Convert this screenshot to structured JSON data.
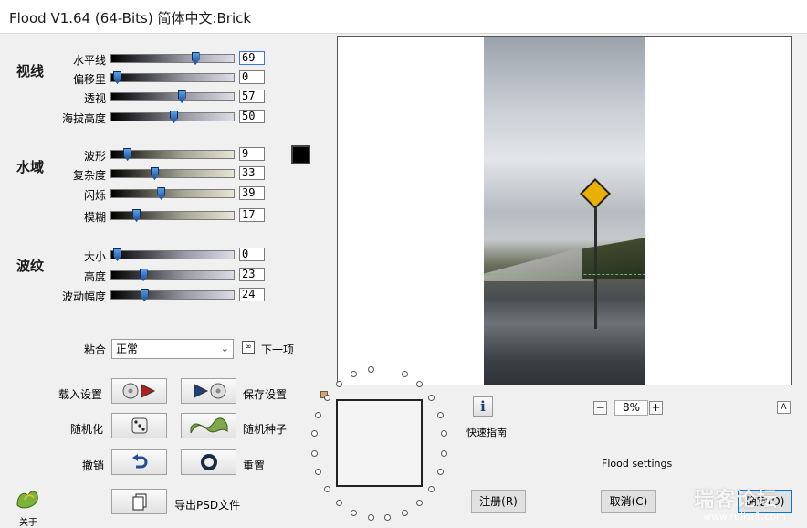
{
  "window": {
    "title": "Flood V1.64 (64-Bits)  简体中文:Brick"
  },
  "groups": {
    "view": {
      "label": "视线"
    },
    "water": {
      "label": "水域"
    },
    "waves": {
      "label": "波纹"
    }
  },
  "sliders": [
    {
      "label": "水平线",
      "value": "69",
      "fraction": 0.69
    },
    {
      "label": "偏移里",
      "value": "0",
      "fraction": 0.0
    },
    {
      "label": "透视",
      "value": "57",
      "fraction": 0.57
    },
    {
      "label": "海拔高度",
      "value": "50",
      "fraction": 0.5
    },
    {
      "label": "波形",
      "value": "9",
      "fraction": 0.09
    },
    {
      "label": "复杂度",
      "value": "33",
      "fraction": 0.33
    },
    {
      "label": "闪烁",
      "value": "39",
      "fraction": 0.39
    },
    {
      "label": "模糊",
      "value": "17",
      "fraction": 0.17
    },
    {
      "label": "大小",
      "value": "0",
      "fraction": 0.0
    },
    {
      "label": "高度",
      "value": "23",
      "fraction": 0.23
    },
    {
      "label": "波动幅度",
      "value": "24",
      "fraction": 0.24
    }
  ],
  "blend": {
    "label": "粘合",
    "selected": "正常",
    "next_label": "下一项"
  },
  "buttons": {
    "load_settings": "载入设置",
    "save_settings": "保存设置",
    "randomize": "随机化",
    "random_seed": "随机种子",
    "undo": "撤销",
    "reset": "重置",
    "export_psd": "导出PSD文件",
    "about": "关于",
    "quick_guide": "快速指南",
    "register": "注册(R)",
    "cancel": "取消(C)",
    "ok": "确定(O)"
  },
  "zoom": {
    "value": "8%"
  },
  "status": {
    "settings_text": "Flood settings"
  },
  "watermark": {
    "main": "瑞客论坛",
    "sub": "www.ruike1.com"
  },
  "colors": {
    "accent": "#0078d7",
    "water_color": "#000000",
    "thumb": "#2a6fc9"
  }
}
